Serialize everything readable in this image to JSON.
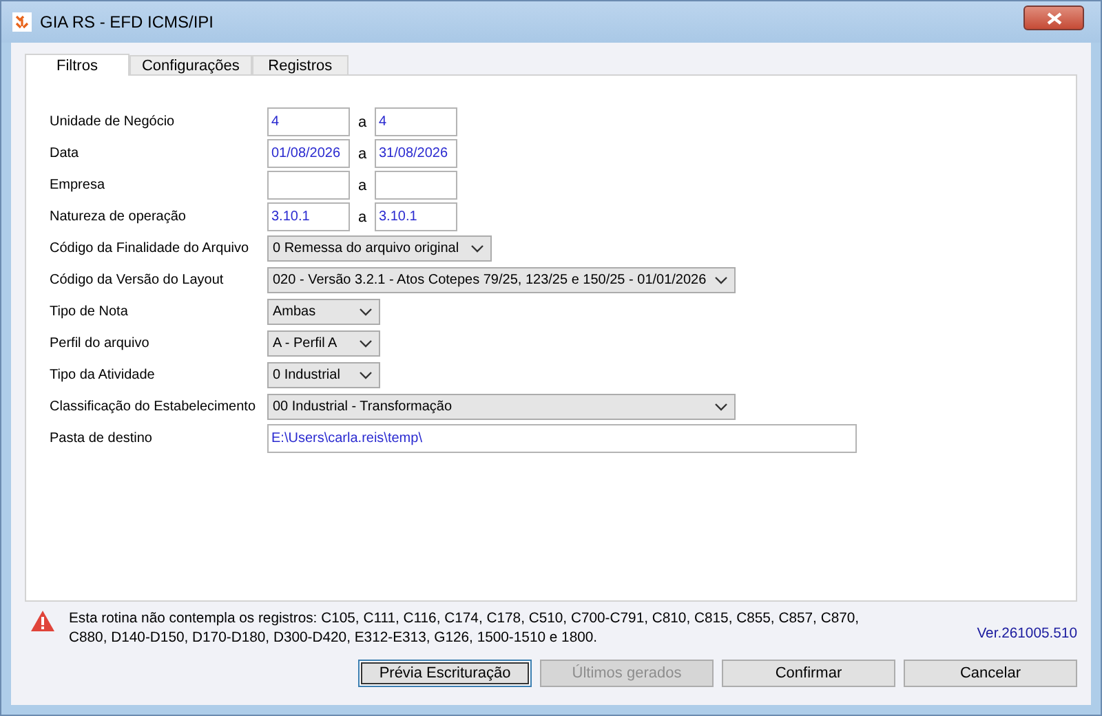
{
  "window": {
    "title": "GIA RS - EFD ICMS/IPI"
  },
  "tabs": [
    {
      "label": "Filtros",
      "selected": true
    },
    {
      "label": "Configurações",
      "selected": false
    },
    {
      "label": "Registros",
      "selected": false
    }
  ],
  "fields": [
    {
      "kind": "range",
      "label": "Unidade de Negócio",
      "from": "4",
      "separator": "a",
      "to": "4"
    },
    {
      "kind": "range",
      "label": "Data",
      "from": "01/08/2026",
      "separator": "a",
      "to": "31/08/2026"
    },
    {
      "kind": "range",
      "label": "Empresa",
      "separator": "a"
    },
    {
      "kind": "range",
      "label": "Natureza de operação",
      "from": "3.10.1",
      "separator": "a",
      "to": "3.10.1"
    },
    {
      "kind": "select",
      "label": "Código da Finalidade do Arquivo",
      "value": "0 Remessa do arquivo original"
    },
    {
      "kind": "select",
      "label": "Código da Versão do Layout",
      "value": "020 - Versão 3.2.1 - Atos Cotepes 79/25, 123/25 e 150/25 - 01/01/2026"
    },
    {
      "kind": "select",
      "label": "Tipo de Nota",
      "value": "Ambas"
    },
    {
      "kind": "select",
      "label": "Perfil do arquivo",
      "value": "A - Perfil A"
    },
    {
      "kind": "select",
      "label": "Tipo da Atividade",
      "value": "0 Industrial"
    },
    {
      "kind": "select",
      "label": "Classificação do Estabelecimento",
      "value": "00 Industrial - Transformação"
    },
    {
      "kind": "text",
      "label": "Pasta de destino",
      "value": "E:\\Users\\carla.reis\\temp\\"
    }
  ],
  "warning": {
    "message": "Esta rotina não contempla os registros: C105, C111, C116, C174, C178, C510, C700-C791, C810, C815, C855, C857, C870, C880, D140-D150, D170-D180, D300-D420, E312-E313, G126, 1500-1510 e 1800."
  },
  "version": "Ver.261005.510",
  "buttons": [
    {
      "label": "Prévia Escrituração",
      "selected": true,
      "disabled": false
    },
    {
      "label": "Últimos gerados",
      "selected": false,
      "disabled": true
    },
    {
      "label": "Confirmar",
      "selected": false,
      "disabled": false
    },
    {
      "label": "Cancelar",
      "selected": false,
      "disabled": false
    }
  ]
}
